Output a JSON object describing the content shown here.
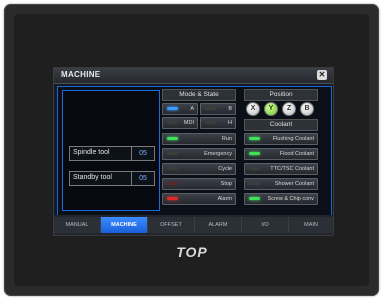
{
  "window": {
    "title": "MACHINE",
    "close_icon": "close-icon"
  },
  "tools": [
    {
      "label": "Spindle tool",
      "value": "05"
    },
    {
      "label": "Standby tool",
      "value": "05"
    }
  ],
  "mode_state": {
    "header": "Mode & State",
    "mode_buttons": [
      {
        "label": "A",
        "lamp": "blue"
      },
      {
        "label": "B",
        "lamp": "off"
      },
      {
        "label": "MDI",
        "lamp": "off"
      },
      {
        "label": "H",
        "lamp": "off"
      }
    ],
    "state_buttons": [
      {
        "label": "Run",
        "lamp": "green"
      },
      {
        "label": "Emergency",
        "lamp": "off"
      },
      {
        "label": "Cycle",
        "lamp": "off"
      },
      {
        "label": "Stop",
        "lamp": "offred"
      },
      {
        "label": "Alarm",
        "lamp": "red"
      }
    ]
  },
  "position": {
    "header": "Position",
    "axes": [
      {
        "label": "X",
        "active": false
      },
      {
        "label": "Y",
        "active": true
      },
      {
        "label": "Z",
        "active": false
      },
      {
        "label": "B",
        "active": false
      }
    ]
  },
  "coolant": {
    "header": "Coolant",
    "buttons": [
      {
        "label": "Flushing Coolant",
        "lamp": "green"
      },
      {
        "label": "Flood Coolant",
        "lamp": "green"
      },
      {
        "label": "TTC/TSC Coolant",
        "lamp": "off"
      },
      {
        "label": "Shower Coolant",
        "lamp": "off"
      },
      {
        "label": "Screw & Chip conv",
        "lamp": "green"
      }
    ]
  },
  "tabs": [
    {
      "label": "MANUAL",
      "active": false
    },
    {
      "label": "MACHINE",
      "active": true
    },
    {
      "label": "OFFSET",
      "active": false
    },
    {
      "label": "ALARM",
      "active": false
    },
    {
      "label": "I/O",
      "active": false
    },
    {
      "label": "MAIN",
      "active": false
    }
  ],
  "brand": {
    "logo_text": "TOP"
  }
}
